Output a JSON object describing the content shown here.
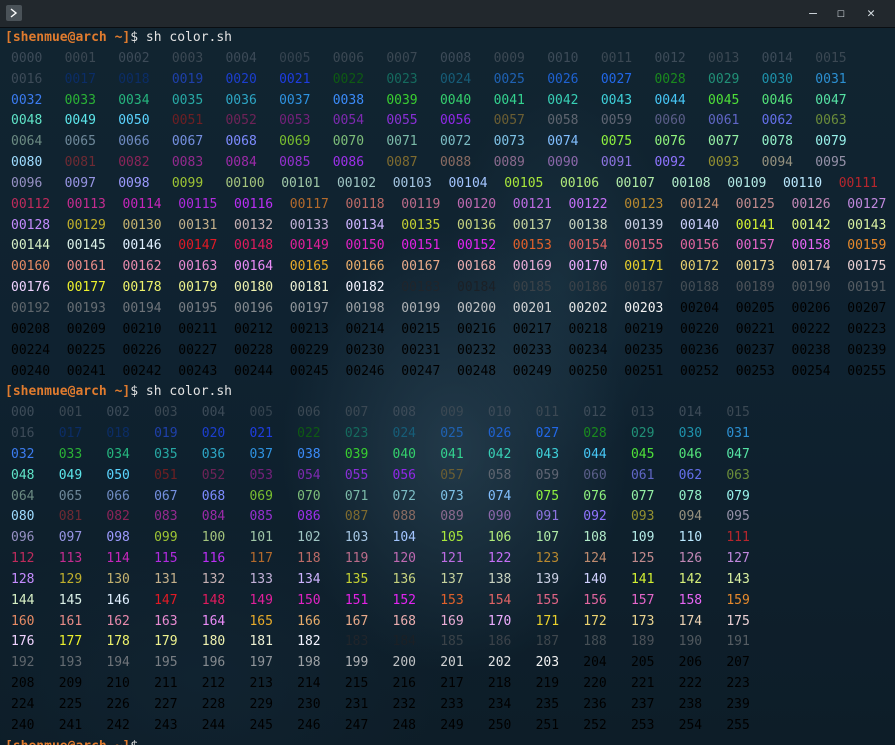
{
  "window": {
    "minimize_glyph": "–",
    "maximize_glyph": "☐",
    "close_glyph": "✕"
  },
  "terminal": {
    "prompt": {
      "open_bracket": "[",
      "user": "shenmue",
      "at": "@",
      "host": "arch",
      "path": " ~",
      "close_bracket": "]",
      "dollar": "$ "
    },
    "command": "sh color.sh",
    "runs": [
      {
        "pad": true
      },
      {
        "pad": false
      }
    ],
    "colors": [
      "#3d4b58",
      "#3b4853",
      "#3d4b58",
      "#3b4853",
      "#3c4a57",
      "#35434f",
      "#3b4853",
      "#3b4853",
      "#3d4b58",
      "#3b4853",
      "#3d4b58",
      "#3b4853",
      "#3d4b58",
      "#3b4853",
      "#3d4b58",
      "#3b4853",
      "#3d4b58",
      "#0b2d66",
      "#0b2d66",
      "#1e40aa",
      "#1c3fcf",
      "#1e3de0",
      "#0e5a13",
      "#156a5e",
      "#165d78",
      "#1f62b3",
      "#1f62d1",
      "#2268e8",
      "#1a8a1e",
      "#219077",
      "#1e92ab",
      "#2c90d2",
      "#3b7cf0",
      "#2ab236",
      "#25b57e",
      "#27a9a5",
      "#2da5c4",
      "#2e92e0",
      "#3b8bf8",
      "#39cf2f",
      "#34d06c",
      "#33d28f",
      "#38cfb5",
      "#3fd0d9",
      "#46c6f5",
      "#4ee038",
      "#52e279",
      "#55e2a4",
      "#5fe4c8",
      "#5ce6eb",
      "#5bd4ff",
      "#6e1f23",
      "#6e2358",
      "#73217a",
      "#7d2ab0",
      "#8a2fd8",
      "#9028e7",
      "#6b5e33",
      "#5f6570",
      "#5f6573",
      "#5a5e89",
      "#6066c6",
      "#6470ea",
      "#6a8c3a",
      "#6b8a82",
      "#6e889a",
      "#6f8bc2",
      "#7590e0",
      "#7d8bff",
      "#78bf2f",
      "#7dbd79",
      "#7bbaa8",
      "#7dbcc4",
      "#7fc2e6",
      "#82bfff",
      "#8ef23f",
      "#8ff27d",
      "#94f0a4",
      "#94f0c8",
      "#98f0ea",
      "#9fdcff",
      "#6e2a33",
      "#8b2459",
      "#932a8e",
      "#9b2aa8",
      "#9530d0",
      "#9d30ea",
      "#7f6b2f",
      "#8a6b62",
      "#8b6a8e",
      "#8c68ab",
      "#8d74e0",
      "#8f74ff",
      "#939030",
      "#95917e",
      "#9591a8",
      "#9691c4",
      "#9795e3",
      "#9d9bff",
      "#9ec534",
      "#a4c47d",
      "#a0c7a8",
      "#a0c5c3",
      "#a5c6e3",
      "#a3c5ff",
      "#a9e83b",
      "#b0ea7a",
      "#b0eaa6",
      "#b1eac8",
      "#b4eae6",
      "#bbe9ff",
      "#b7262d",
      "#bf2b5c",
      "#c42c90",
      "#c626bb",
      "#b12bdf",
      "#bb2ef5",
      "#b36a2c",
      "#bb6a66",
      "#bb6c8a",
      "#bf6ab2",
      "#bd6ce2",
      "#c670f7",
      "#b9892f",
      "#bf8b6f",
      "#c18a8d",
      "#c288b6",
      "#c189de",
      "#c58cff",
      "#c0b02c",
      "#c5b26f",
      "#c5b18c",
      "#c6b1b4",
      "#c3b2d9",
      "#ceb4ff",
      "#c3d033",
      "#c7d37f",
      "#c6d29e",
      "#c9d3c0",
      "#cad0e3",
      "#d0d2ff",
      "#d3f032",
      "#d7f07a",
      "#daf0a2",
      "#d7f0c5",
      "#dbf0e7",
      "#e1f0ff",
      "#e11a25",
      "#e01b5d",
      "#e0209a",
      "#e023c3",
      "#e422e4",
      "#e325f3",
      "#e1612b",
      "#e06465",
      "#e26586",
      "#e2669f",
      "#e466c9",
      "#e766f4",
      "#e78a2c",
      "#e58a64",
      "#e88b87",
      "#e88aac",
      "#e98bd2",
      "#eb8cf7",
      "#e8ab2a",
      "#e8ac6b",
      "#e8aa8a",
      "#ebadaf",
      "#e9acd5",
      "#eeadff",
      "#ead12c",
      "#ead16e",
      "#ead38e",
      "#ebd1b2",
      "#ebd1d4",
      "#f0d3ff",
      "#ecf02c",
      "#eef26b",
      "#eef28e",
      "#eef1af",
      "#edf0d4",
      "#f3f3ff",
      "#20252b",
      "#1b2026",
      "#3a4248",
      "#3b4249",
      "#3f474d",
      "#454e55",
      "#4d5259",
      "#51585e",
      "#565d63",
      "#5f666c",
      "#656c72",
      "#6e7379",
      "#797e84",
      "#858a8f",
      "#90959a",
      "#9da1a5",
      "#aeb1b4",
      "#bfc1c3",
      "#d0d1d2",
      "#e2e3e3",
      "#f2f2f2"
    ]
  }
}
